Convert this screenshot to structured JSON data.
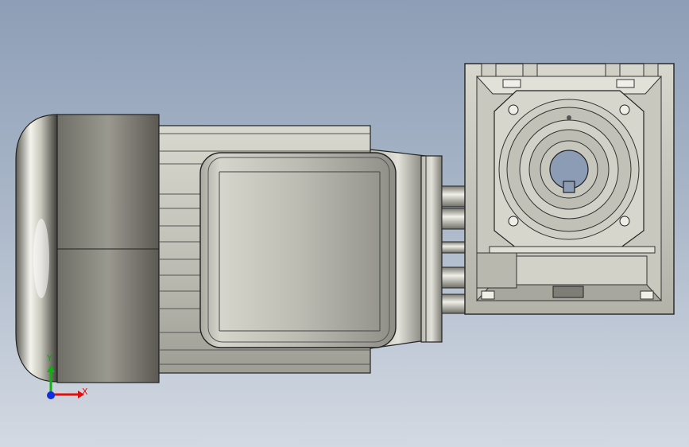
{
  "view": {
    "background_top": "#8d9eb6",
    "background_bottom": "#d3d9e2",
    "model_color": "#c4c3b8"
  },
  "triad": {
    "x_label": "X",
    "y_label": "Y",
    "x_color": "#e01010",
    "y_color": "#10b010",
    "z_color": "#1030e0"
  }
}
